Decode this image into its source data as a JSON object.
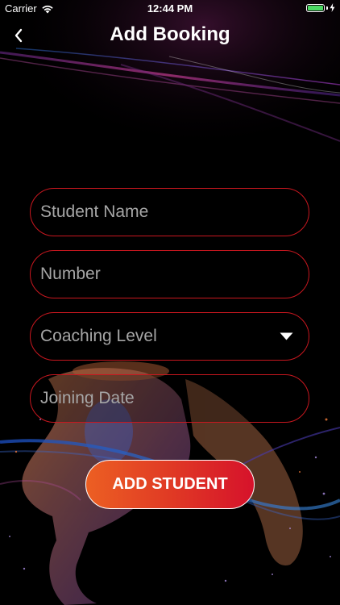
{
  "status_bar": {
    "carrier": "Carrier",
    "time": "12:44 PM",
    "wifi_icon": "wifi-icon",
    "battery_icon": "battery-icon",
    "battery_level": 1.0,
    "battery_color": "#4cd964"
  },
  "nav": {
    "title": "Add Booking",
    "back_icon": "chevron-left-icon"
  },
  "form": {
    "student_name": {
      "placeholder": "Student Name",
      "value": ""
    },
    "number": {
      "placeholder": "Number",
      "value": ""
    },
    "coaching_level": {
      "placeholder": "Coaching Level",
      "icon": "caret-down-icon"
    },
    "joining_date": {
      "placeholder": "Joining Date",
      "value": ""
    }
  },
  "submit": {
    "label": "ADD STUDENT"
  },
  "colors": {
    "background": "#000000",
    "field_border": "#c8171f",
    "button_gradient_start": "#ec5f23",
    "button_gradient_end": "#d6122b",
    "placeholder": "#a6a6a6"
  }
}
